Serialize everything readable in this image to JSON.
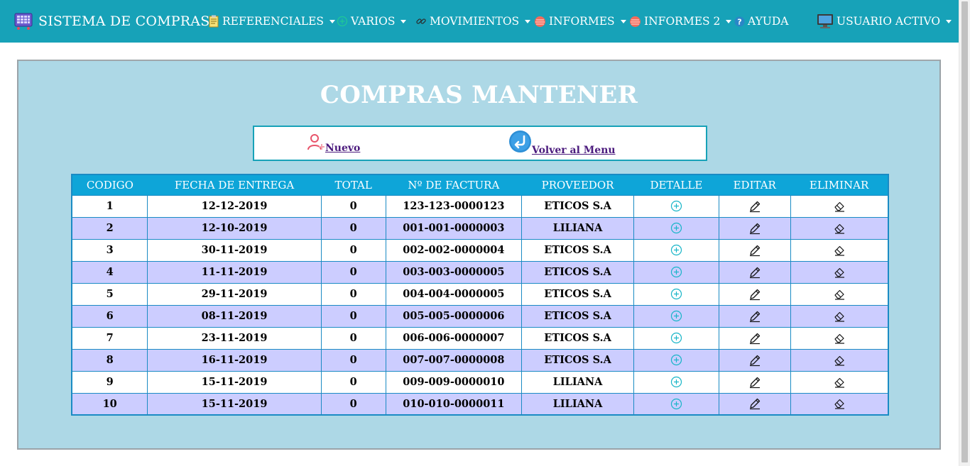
{
  "app": {
    "title": "SISTEMA DE COMPRAS"
  },
  "nav": {
    "items": [
      {
        "label": "REFERENCIALES",
        "icon": "notepad-icon"
      },
      {
        "label": "VARIOS",
        "icon": "plus-circle-icon"
      },
      {
        "label": "MOVIMIENTOS",
        "icon": "link-icon"
      },
      {
        "label": "INFORMES",
        "icon": "report-icon"
      },
      {
        "label": "INFORMES 2",
        "icon": "report-icon"
      },
      {
        "label": "AYUDA",
        "icon": "help-icon"
      },
      {
        "label": "USUARIO ACTIVO",
        "icon": "monitor-icon"
      }
    ]
  },
  "page": {
    "title": "COMPRAS MANTENER"
  },
  "actions": {
    "nuevo_label": "Nuevo",
    "volver_label": "Volver al Menu"
  },
  "table": {
    "headers": [
      "CODIGO",
      "FECHA DE ENTREGA",
      "TOTAL",
      "Nº DE FACTURA",
      "PROVEEDOR",
      "DETALLE",
      "EDITAR",
      "ELIMINAR"
    ],
    "rows": [
      {
        "codigo": "1",
        "fecha": "12-12-2019",
        "total": "0",
        "factura": "123-123-0000123",
        "proveedor": "ETICOS S.A"
      },
      {
        "codigo": "2",
        "fecha": "12-10-2019",
        "total": "0",
        "factura": "001-001-0000003",
        "proveedor": "LILIANA"
      },
      {
        "codigo": "3",
        "fecha": "30-11-2019",
        "total": "0",
        "factura": "002-002-0000004",
        "proveedor": "ETICOS S.A"
      },
      {
        "codigo": "4",
        "fecha": "11-11-2019",
        "total": "0",
        "factura": "003-003-0000005",
        "proveedor": "ETICOS S.A"
      },
      {
        "codigo": "5",
        "fecha": "29-11-2019",
        "total": "0",
        "factura": "004-004-0000005",
        "proveedor": "ETICOS S.A"
      },
      {
        "codigo": "6",
        "fecha": "08-11-2019",
        "total": "0",
        "factura": "005-005-0000006",
        "proveedor": "ETICOS S.A"
      },
      {
        "codigo": "7",
        "fecha": "23-11-2019",
        "total": "0",
        "factura": "006-006-0000007",
        "proveedor": "ETICOS S.A"
      },
      {
        "codigo": "8",
        "fecha": "16-11-2019",
        "total": "0",
        "factura": "007-007-0000008",
        "proveedor": "ETICOS S.A"
      },
      {
        "codigo": "9",
        "fecha": "15-11-2019",
        "total": "0",
        "factura": "009-009-0000010",
        "proveedor": "LILIANA"
      },
      {
        "codigo": "10",
        "fecha": "15-11-2019",
        "total": "0",
        "factura": "010-010-0000011",
        "proveedor": "LILIANA"
      }
    ]
  },
  "colors": {
    "navbar": "#17a2b8",
    "panel": "#add8e6",
    "table_header": "#0ea5d8",
    "row_alt": "#cccdff",
    "detail_icon": "#19b5c8",
    "link": "#4b1a7d"
  }
}
